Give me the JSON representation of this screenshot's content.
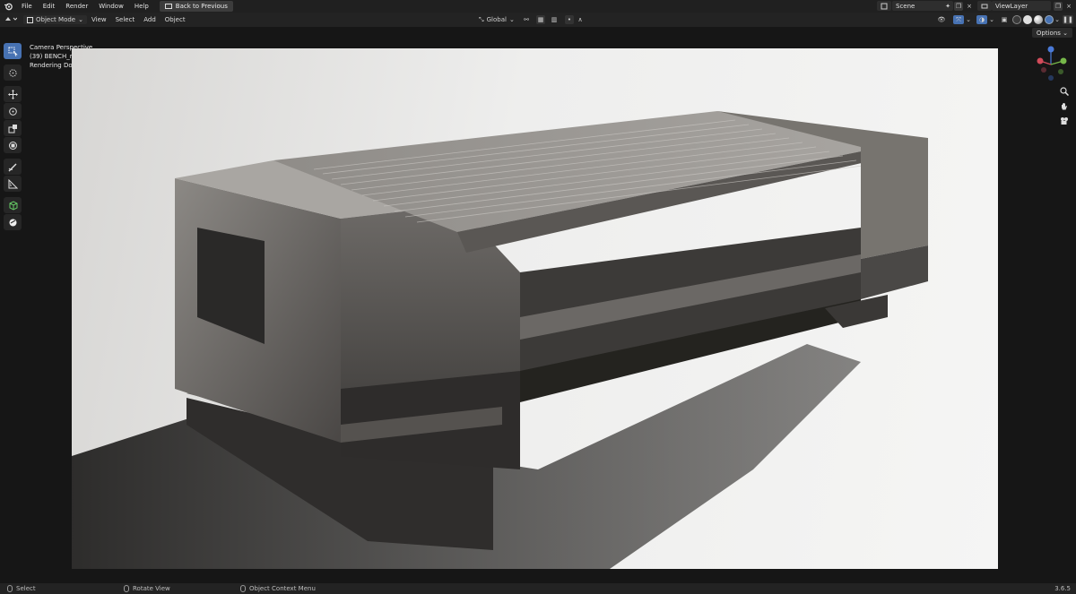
{
  "menu": {
    "items": [
      "File",
      "Edit",
      "Render",
      "Window",
      "Help"
    ],
    "back_button": "Back to Previous"
  },
  "top_right": {
    "scene_value": "Scene",
    "view_layer_value": "ViewLayer"
  },
  "header": {
    "mode": "Object Mode",
    "items": [
      "View",
      "Select",
      "Add",
      "Object"
    ],
    "transform_orientation": "Global"
  },
  "options_label": "Options",
  "overlay": {
    "line1": "Camera Perspective",
    "line2": "(39) BENCH_mo",
    "line3": "Rendering Done"
  },
  "statusbar": {
    "select": "Select",
    "rotate": "Rotate View",
    "context": "Object Context Menu",
    "version": "3.6.5"
  },
  "colors": {
    "accent": "#4772b3",
    "panel": "#232323",
    "background": "#161616"
  },
  "icons": {
    "toolbar": [
      "select-box-icon",
      "cursor-icon",
      "move-icon",
      "rotate-icon",
      "scale-icon",
      "transform-icon",
      "annotate-icon",
      "measure-icon",
      "add-cube-icon",
      "extrude-icon"
    ],
    "nav": [
      "zoom-icon",
      "hand-icon",
      "camera-icon"
    ]
  }
}
